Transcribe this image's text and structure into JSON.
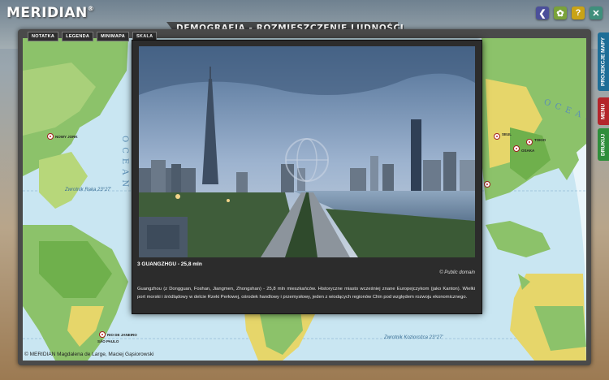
{
  "app": {
    "logo": "MERIDIAN",
    "logo_mark": "®",
    "title": "DEMOGRAFIA - ROZMIESZCZENIE LUDNOŚCI"
  },
  "top_icons": [
    {
      "name": "back-icon",
      "glyph": "❮"
    },
    {
      "name": "gear-icon",
      "glyph": "✿"
    },
    {
      "name": "help-icon",
      "glyph": "?"
    },
    {
      "name": "close-icon",
      "glyph": "✕"
    }
  ],
  "tabs": [
    "NOTATKA",
    "LEGENDA",
    "MINIMAPA",
    "SKALA"
  ],
  "side_buttons": {
    "projections": "PROJEKCJE MAPY",
    "menu": "MENU",
    "print": "DRUKUJ"
  },
  "map": {
    "ocean_left": "OCEAN",
    "ocean_right": "OCEAN",
    "tropic_cancer": "Zwrotnik Raka 23°27'",
    "tropic_capricorn": "Zwrotnik Koziorożca 23°27'",
    "cities": [
      "NOWY JORK",
      "RIO DE JANEIRO",
      "SÃO PAULO",
      "SEUL",
      "TOKIO",
      "OSAKA"
    ],
    "copyright": "© MERIDIAN Magdalena de Large, Maciej Gąsiorowski"
  },
  "popup": {
    "caption": "3 GUANGZHGU - 25,8 mln",
    "credit": "© Public domain",
    "description": "Guangzhou (z Dongguan, Foshan, Jiangmen, Zhongshan) - 25,8 mln mieszkańców. Historyczne miasto wcześniej znane Europejczykom (jako Kanton). Wielki port morski i śródlądowy w delcie Rzeki Perłowej, ośrodek handlowy i przemysłowy, jeden z wiodących regionów Chin pod względem rozwoju ekonomicznego."
  },
  "colors": {
    "ocean": "#c9e6f2",
    "land_green": "#8cc26a",
    "land_yellow": "#e6d66a",
    "side_projections": "#1e6e97",
    "side_menu": "#b3252b",
    "side_print": "#2f8e3b"
  }
}
